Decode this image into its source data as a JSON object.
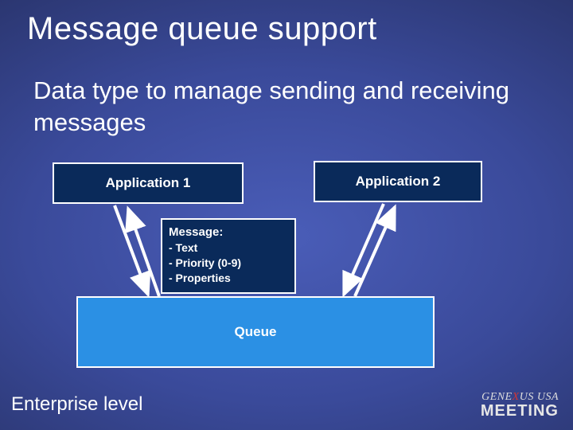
{
  "title": "Message queue support",
  "subtitle": "Data type to manage sending and receiving messages",
  "app1": "Application 1",
  "app2": "Application 2",
  "message": {
    "header": "Message:",
    "line1": "- Text",
    "line2": "- Priority (0-9)",
    "line3": "- Properties"
  },
  "queue": "Queue",
  "footer": "Enterprise level",
  "logo": {
    "top_pre": "GENE",
    "top_x": "X",
    "top_post": "US USA",
    "bottom": "MEETING"
  }
}
